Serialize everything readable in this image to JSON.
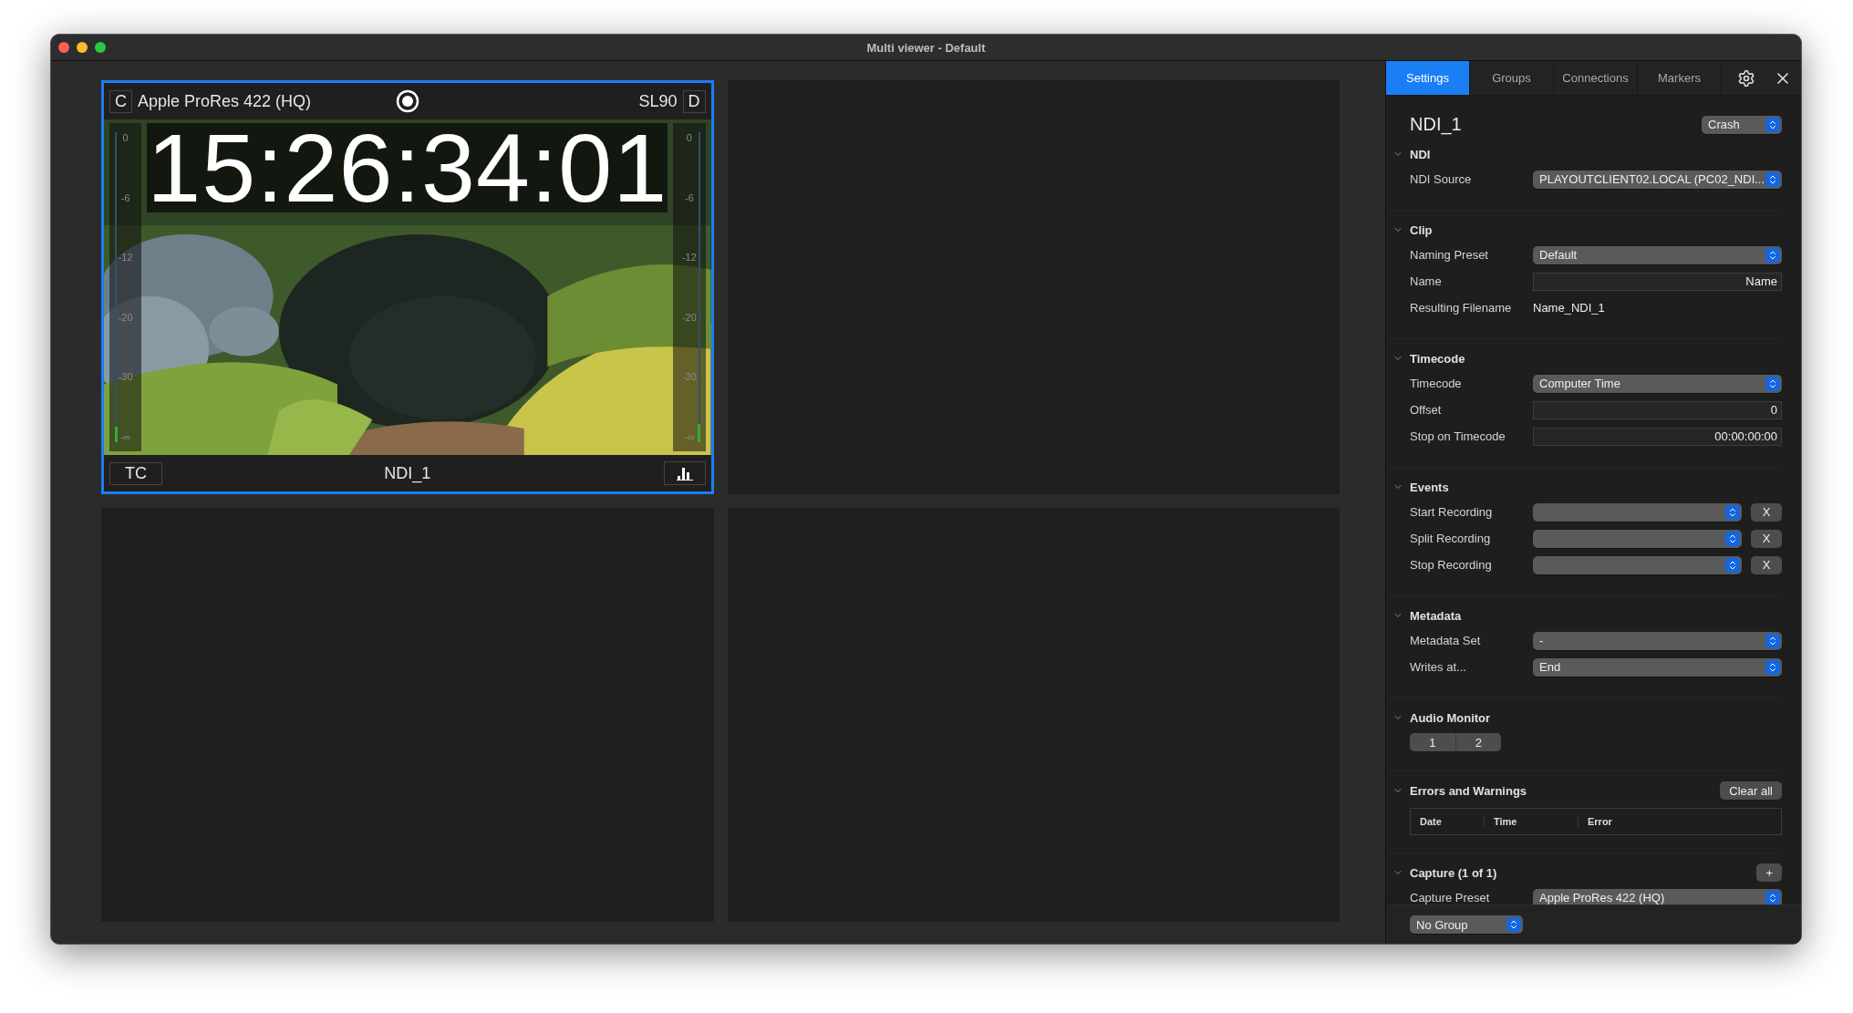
{
  "window": {
    "title": "Multi viewer - Default"
  },
  "viewer": {
    "tiles": [
      {
        "kind": "source",
        "selected": true,
        "left_button": "C",
        "codec": "Apple ProRes 422 (HQ)",
        "recording": true,
        "level_label": "SL90",
        "right_button": "D",
        "timecode": "15:26:34:01",
        "tc_button": "TC",
        "name": "NDI_1",
        "meters": [
          {
            "ticks": [
              "0",
              "-6",
              "-12",
              "-20",
              "-30",
              "-∞"
            ],
            "level": 0.05
          },
          {
            "ticks": [
              "0",
              "-6",
              "-12",
              "-20",
              "-30",
              "-∞"
            ],
            "level": 0.06
          }
        ]
      },
      {
        "kind": "empty",
        "selected": false
      },
      {
        "kind": "empty",
        "selected": false
      },
      {
        "kind": "empty",
        "selected": false
      }
    ]
  },
  "panel": {
    "tabs": [
      {
        "label": "Settings",
        "selected": true
      },
      {
        "label": "Groups",
        "selected": false
      },
      {
        "label": "Connections",
        "selected": false
      },
      {
        "label": "Markers",
        "selected": false
      }
    ],
    "title": "NDI_1",
    "title_select": "Crash",
    "sections": [
      {
        "title": "NDI",
        "expanded": true,
        "rows": [
          {
            "kind": "select",
            "label": "NDI Source",
            "value": "PLAYOUTCLIENT02.LOCAL (PC02_NDI..."
          }
        ]
      },
      {
        "title": "Clip",
        "expanded": true,
        "rows": [
          {
            "kind": "select",
            "label": "Naming Preset",
            "value": "Default"
          },
          {
            "kind": "input",
            "label": "Name",
            "placeholder": "Name"
          },
          {
            "kind": "text",
            "label": "Resulting Filename",
            "value": "Name_NDI_1"
          }
        ]
      },
      {
        "title": "Timecode",
        "expanded": true,
        "rows": [
          {
            "kind": "select",
            "label": "Timecode",
            "value": "Computer Time"
          },
          {
            "kind": "input",
            "label": "Offset",
            "value": "0"
          },
          {
            "kind": "input",
            "label": "Stop on Timecode",
            "value": "00:00:00:00"
          }
        ]
      },
      {
        "title": "Events",
        "expanded": true,
        "rows": [
          {
            "kind": "clearable",
            "label": "Start Recording",
            "clear": "X"
          },
          {
            "kind": "clearable",
            "label": "Split Recording",
            "clear": "X"
          },
          {
            "kind": "clearable",
            "label": "Stop Recording",
            "clear": "X"
          }
        ]
      },
      {
        "title": "Metadata",
        "expanded": true,
        "rows": [
          {
            "kind": "select",
            "label": "Metadata Set",
            "value": "-"
          },
          {
            "kind": "select",
            "label": "Writes at...",
            "value": "End"
          }
        ]
      },
      {
        "title": "Audio Monitor",
        "expanded": true,
        "rows": [
          {
            "kind": "segments",
            "segments": [
              "1",
              "2"
            ]
          }
        ]
      },
      {
        "title": "Errors and Warnings",
        "expanded": true,
        "action": "Clear all",
        "rows": [
          {
            "kind": "table",
            "columns": [
              "Date",
              "Time",
              "Error"
            ]
          }
        ]
      },
      {
        "title": "Capture (1 of 1)",
        "expanded": true,
        "action": "+",
        "rows": [
          {
            "kind": "select",
            "label": "Capture Preset",
            "value": "Apple ProRes 422 (HQ)"
          }
        ]
      }
    ],
    "footer_select": "No Group"
  }
}
